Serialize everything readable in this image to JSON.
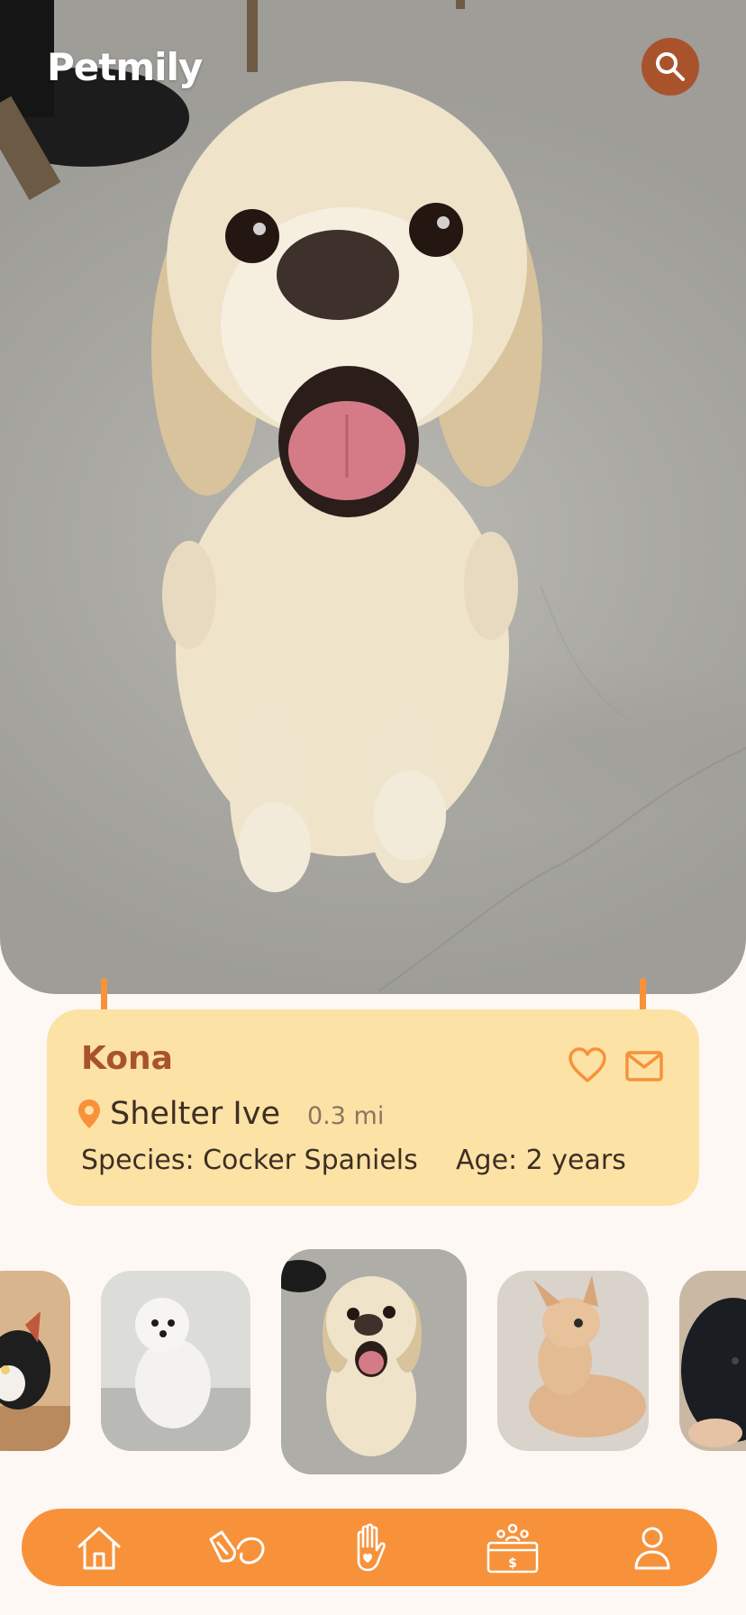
{
  "app": {
    "brand": "Petmily"
  },
  "header": {
    "search_icon": "search-icon"
  },
  "pet": {
    "name": "Kona",
    "shelter": "Shelter Ive",
    "distance": "0.3 mi",
    "species": "Species: Cocker Spaniels",
    "age": "Age: 2 years"
  },
  "actions": {
    "favorite_icon": "heart-icon",
    "message_icon": "mail-icon"
  },
  "thumbnails": [
    {
      "subject": "calico kitten"
    },
    {
      "subject": "white maltese"
    },
    {
      "subject": "cocker spaniel",
      "selected": true
    },
    {
      "subject": "orange kitten"
    },
    {
      "subject": "black spitz"
    }
  ],
  "nav": {
    "items": [
      {
        "icon": "home-icon"
      },
      {
        "icon": "care-hands-icon"
      },
      {
        "icon": "heart-hand-icon"
      },
      {
        "icon": "donation-icon"
      },
      {
        "icon": "profile-icon"
      }
    ]
  },
  "colors": {
    "accent": "#f7923b",
    "brown": "#a9532d",
    "card": "#fde2a6",
    "background": "#fdf8f3"
  }
}
